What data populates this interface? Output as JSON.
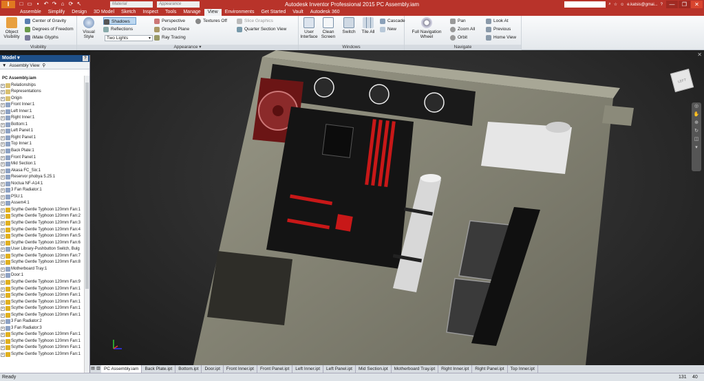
{
  "titlebar": {
    "app_letter": "I",
    "material_placeholder": "Material",
    "appearance_placeholder": "Appearance",
    "title": "Autodesk Inventor Professional 2015    PC Assembly.iam",
    "user": "e.katsis@gmai...",
    "min": "—",
    "max": "❐",
    "close": "✕"
  },
  "tabs": [
    "Assemble",
    "Simplify",
    "Design",
    "3D Model",
    "Sketch",
    "Inspect",
    "Tools",
    "Manage",
    "View",
    "Environments",
    "Get Started",
    "Vault",
    "Autodesk 360"
  ],
  "active_tab": "View",
  "ribbon": {
    "visibility": {
      "label": "Visibility",
      "object_visibility": "Object Visibility",
      "center_of_gravity": "Center of Gravity",
      "degrees_of_freedom": "Degrees of Freedom",
      "imate_glyphs": "iMate Glyphs"
    },
    "appearance": {
      "label": "Appearance ▾",
      "visual_style": "Visual Style",
      "shadows": "Shadows",
      "reflections": "Reflections",
      "lighting": "Two Lights",
      "perspective": "Perspective",
      "ground_plane": "Ground Plane",
      "ray_tracing": "Ray Tracing",
      "textures_off": "Textures Off",
      "slice_graphics": "Slice Graphics",
      "quarter_section_view": "Quarter Section View"
    },
    "windows": {
      "label": "Windows",
      "user_interface": "User Interface",
      "clean_screen": "Clean Screen",
      "switch": "Switch",
      "tile_all": "Tile All",
      "cascade": "Cascade",
      "new": "New"
    },
    "navigate": {
      "label": "Navigate",
      "full_navigation_wheel": "Full Navigation Wheel",
      "pan": "Pan",
      "zoom_all": "Zoom All",
      "orbit": "Orbit",
      "look_at": "Look At",
      "previous": "Previous",
      "home_view": "Home View"
    }
  },
  "browser": {
    "title": "Model ▾",
    "help": "?",
    "assembly_view": "Assembly View",
    "root": "PC Assembly.iam",
    "items": [
      "Relationships",
      "Representations",
      "Origin",
      "Front Inner:1",
      "Left Inner:1",
      "Right Inner:1",
      "Bottom:1",
      "Left Panel:1",
      "Right Panel:1",
      "Top Inner:1",
      "Back Plate:1",
      "Front Panel:1",
      "Mid Section:1",
      "Akasa FC_Six:1",
      "Reservor phobya 5.25:1",
      "Noctua NF-A14:1",
      "3 Fan Radiator:1",
      "PSU:1",
      "Assem4:1",
      "Scythe Gentle Typhoon 120mm Fan:1",
      "Scythe Gentle Typhoon 120mm Fan:2",
      "Scythe Gentle Typhoon 120mm Fan:3",
      "Scythe Gentle Typhoon 120mm Fan:4",
      "Scythe Gentle Typhoon 120mm Fan:5",
      "Scythe Gentle Typhoon 120mm Fan:6",
      "User Library-Pushbutton Switch, Bulg",
      "Scythe Gentle Typhoon 120mm Fan:7",
      "Scythe Gentle Typhoon 120mm Fan:8",
      "Motherboard Tray:1",
      "Door:1",
      "Scythe Gentle Typhoon 120mm Fan:9",
      "Scythe Gentle Typhoon 120mm Fan:1",
      "Scythe Gentle Typhoon 120mm Fan:1",
      "Scythe Gentle Typhoon 120mm Fan:1",
      "Scythe Gentle Typhoon 120mm Fan:1",
      "Scythe Gentle Typhoon 120mm Fan:1",
      "3 Fan Radiator:2",
      "3 Fan Radiator:3",
      "Scythe Gentle Typhoon 120mm Fan:1",
      "Scythe Gentle Typhoon 120mm Fan:1",
      "Scythe Gentle Typhoon 120mm Fan:1",
      "Scythe Gentle Typhoon 120mm Fan:1"
    ]
  },
  "viewcube_label": "LEFT",
  "doc_tabs": [
    "PC Assembly.iam",
    "Back Plate.ipt",
    "Bottom.ipt",
    "Door.ipt",
    "Front Inner.ipt",
    "Front Panel.ipt",
    "Left Inner.ipt",
    "Left Panel.ipt",
    "Mid Section.ipt",
    "Motherboard Tray.ipt",
    "Right Inner.ipt",
    "Right Panel.ipt",
    "Top Inner.ipt"
  ],
  "status": {
    "text": "Ready",
    "n1": "131",
    "n2": "40"
  },
  "colors": {
    "accent": "#b8332a",
    "model_body": "#8b8a7a",
    "ram_red": "#c81818"
  }
}
